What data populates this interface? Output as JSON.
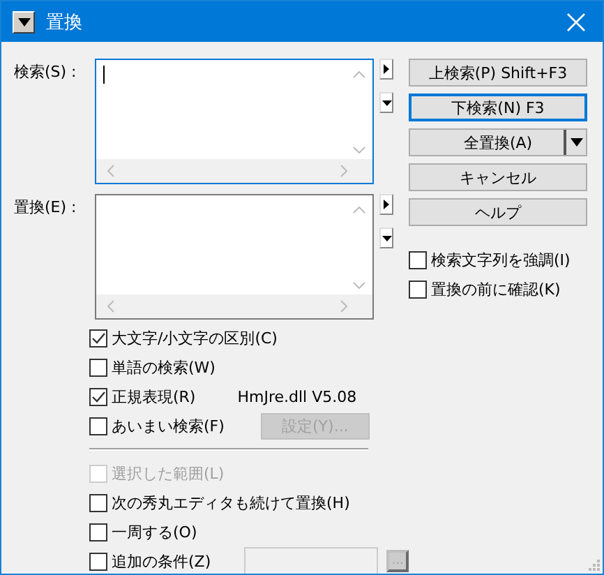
{
  "window": {
    "title": "置換"
  },
  "fields": [
    {
      "label": "検索(S) :",
      "focused": true
    },
    {
      "label": "置換(E) :",
      "focused": false
    }
  ],
  "buttons": [
    {
      "label": "上検索(P) Shift+F3",
      "default": false,
      "dropdown": false
    },
    {
      "label": "下検索(N) F3",
      "default": true,
      "dropdown": false
    },
    {
      "label": "全置換(A)",
      "default": false,
      "dropdown": true
    },
    {
      "label": "キャンセル",
      "default": false,
      "dropdown": false
    },
    {
      "label": "ヘルプ",
      "default": false,
      "dropdown": false
    }
  ],
  "side_options": [
    {
      "label": "検索文字列を強調(I)",
      "checked": false
    },
    {
      "label": "置換の前に確認(K)",
      "checked": false
    }
  ],
  "options": [
    {
      "kind": "plain",
      "label": "大文字/小文字の区別(C)",
      "checked": true,
      "disabled": false
    },
    {
      "kind": "plain",
      "label": "単語の検索(W)",
      "checked": false,
      "disabled": false
    },
    {
      "kind": "note",
      "label": "正規表現(R)",
      "checked": true,
      "disabled": false,
      "note": "HmJre.dll V5.08"
    },
    {
      "kind": "button",
      "label": "あいまい検索(F)",
      "checked": false,
      "disabled": false,
      "button": {
        "label": "設定(Y)...",
        "disabled": true
      }
    },
    {
      "kind": "separator"
    },
    {
      "kind": "plain",
      "label": "選択した範囲(L)",
      "checked": false,
      "disabled": true
    },
    {
      "kind": "plain",
      "label": "次の秀丸エディタも続けて置換(H)",
      "checked": false,
      "disabled": false
    },
    {
      "kind": "plain",
      "label": "一周する(O)",
      "checked": false,
      "disabled": false
    },
    {
      "kind": "field",
      "label": "追加の条件(Z)",
      "checked": false,
      "disabled": false,
      "button": {
        "label": "...",
        "disabled": true
      }
    }
  ]
}
